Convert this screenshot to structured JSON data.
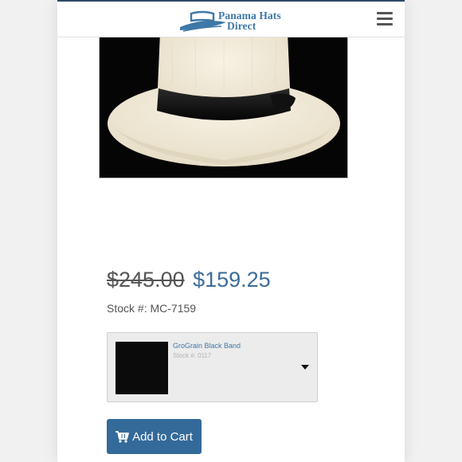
{
  "brand": {
    "name_line1": "Panama Hats",
    "name_line2": "Direct",
    "color": "#3e78a8"
  },
  "header": {
    "menu_icon": "hamburger-menu-icon"
  },
  "product": {
    "image_desc": "white panama hat with black band",
    "price_old": "$245.00",
    "price_new": "$159.25",
    "stock_label": "Stock #: MC-7159"
  },
  "band_option": {
    "name": "GroGrain Black Band",
    "stock": "Stock #: 0117",
    "icon": "caret-down-icon"
  },
  "cart": {
    "button_label": "Add to Cart",
    "icon": "shopping-cart-icon",
    "color": "#336a9a"
  }
}
